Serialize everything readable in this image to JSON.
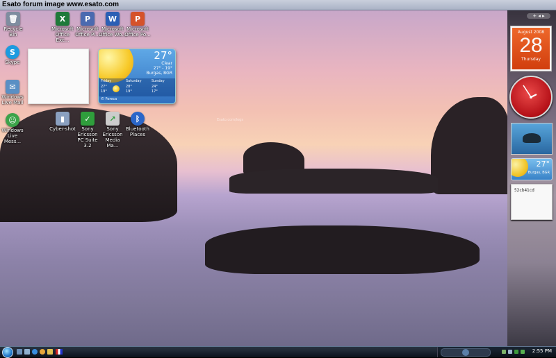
{
  "banner": {
    "title": "Esato forum image www.esato.com"
  },
  "desktop": {
    "icons": [
      {
        "label": "Recycle Bin",
        "glyph": "🗑",
        "color": "#7f8da0"
      },
      {
        "label": "Microsoft Office Exc...",
        "glyph": "X",
        "color": "#1f7a3a"
      },
      {
        "label": "Microsoft Office Pi...",
        "glyph": "P",
        "color": "#4b6ab0"
      },
      {
        "label": "Microsoft Office Wo...",
        "glyph": "W",
        "color": "#2b5fb5"
      },
      {
        "label": "Microsoft Office Po...",
        "glyph": "P",
        "color": "#d5522a"
      },
      {
        "label": "Skype",
        "glyph": "S",
        "color": "#1c9be0"
      },
      {
        "label": "Windows Live Mail",
        "glyph": "✉",
        "color": "#5a8fc4"
      },
      {
        "label": "Windows Live Mess...",
        "glyph": "☺",
        "color": "#3da34a"
      },
      {
        "label": "Cyber-shot",
        "glyph": "▮",
        "color": "#8aa0c0"
      },
      {
        "label": "Sony Ericsson PC Suite 3.2",
        "glyph": "✓",
        "color": "#2f9e3c"
      },
      {
        "label": "Sony Ericsson Media Ma...",
        "glyph": "↗",
        "color": "#cccccc"
      },
      {
        "label": "Bluetooth Places",
        "glyph": "ᛒ",
        "color": "#2a66c9"
      }
    ],
    "weather_gadget": {
      "temp": "27°",
      "condition": "Clear",
      "hilo": "27° - 19°",
      "location": "Burgas, BGR",
      "forecast": [
        {
          "day": "Friday",
          "hi": "27°",
          "lo": "19°"
        },
        {
          "day": "Saturday",
          "hi": "28°",
          "lo": "19°"
        },
        {
          "day": "Sunday",
          "hi": "24°",
          "lo": "17°"
        }
      ],
      "provider": "© Foreca"
    },
    "watermark": "Esato.com/logs"
  },
  "sidebar": {
    "calendar": {
      "month_year": "August 2008",
      "day": "28",
      "weekday": "Thursday"
    },
    "clock": {
      "hours": 2,
      "minutes": 55
    },
    "mini_weather": {
      "temp": "27°",
      "location": "Burgas, BGR"
    },
    "note": {
      "text": "52cb41cd"
    }
  },
  "taskbar": {
    "time": "2:55 PM"
  },
  "colors": {
    "sidebar_calendar": "#e24a12",
    "clock_face": "#c91c22"
  }
}
